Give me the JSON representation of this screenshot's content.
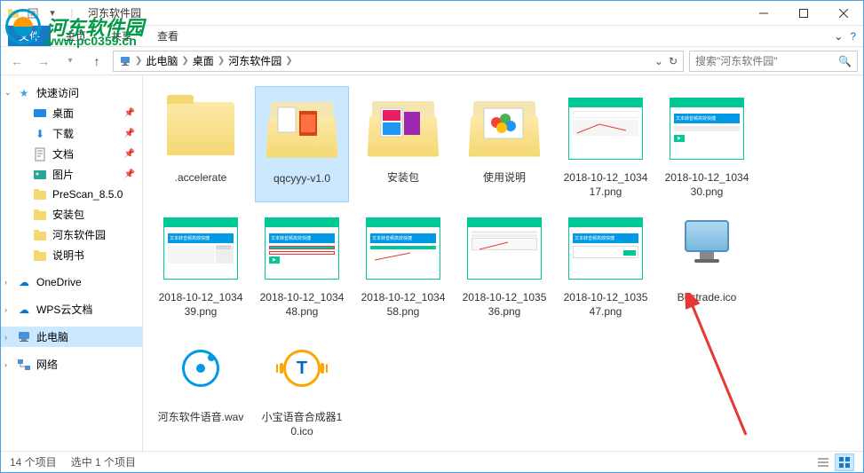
{
  "title": "河东软件园",
  "watermark": {
    "text": "河东软件园",
    "url": "www.pc0359.cn"
  },
  "ribbon": {
    "file": "文件",
    "home": "主页",
    "share": "共享",
    "view": "查看"
  },
  "breadcrumb": {
    "pc": "此电脑",
    "desktop": "桌面",
    "folder": "河东软件园"
  },
  "search": {
    "placeholder": "搜索\"河东软件园\""
  },
  "sidebar": {
    "quick": "快速访问",
    "desktop": "桌面",
    "downloads": "下载",
    "documents": "文档",
    "pictures": "图片",
    "prescan": "PreScan_8.5.0",
    "installpkg": "安装包",
    "hedong": "河东软件园",
    "manual": "说明书",
    "onedrive": "OneDrive",
    "wps": "WPS云文档",
    "thispc": "此电脑",
    "network": "网络"
  },
  "files": [
    {
      "name": ".accelerate",
      "type": "folder"
    },
    {
      "name": "qqcyyy-v1.0",
      "type": "folder-open-pics"
    },
    {
      "name": "安装包",
      "type": "folder-open-colors"
    },
    {
      "name": "使用说明",
      "type": "folder-open-balls"
    },
    {
      "name": "2018-10-12_103417.png",
      "type": "png"
    },
    {
      "name": "2018-10-12_103430.png",
      "type": "png"
    },
    {
      "name": "2018-10-12_103439.png",
      "type": "png"
    },
    {
      "name": "2018-10-12_103448.png",
      "type": "png"
    },
    {
      "name": "2018-10-12_103458.png",
      "type": "png"
    },
    {
      "name": "2018-10-12_103536.png",
      "type": "png"
    },
    {
      "name": "2018-10-12_103547.png",
      "type": "png"
    },
    {
      "name": "Bestrade.ico",
      "type": "ico-monitor"
    },
    {
      "name": "河东软件语音.wav",
      "type": "wav"
    },
    {
      "name": "小宝语音合成器10.ico",
      "type": "ico-t"
    }
  ],
  "status": {
    "count": "14 个项目",
    "selected": "选中 1 个项目"
  },
  "png_inner": "文本转音频高效快捷"
}
